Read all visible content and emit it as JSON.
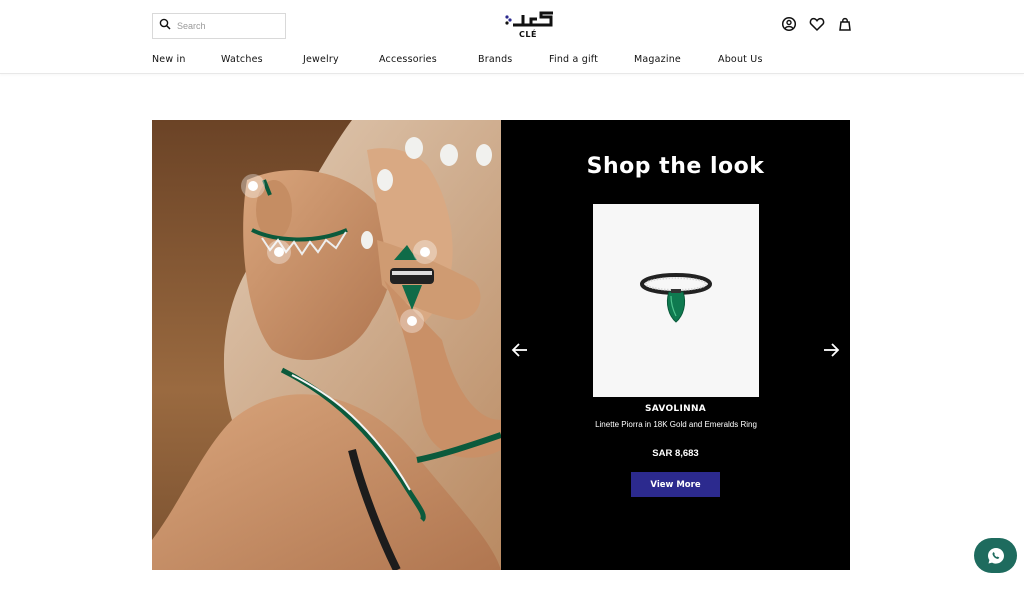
{
  "header": {
    "search": {
      "placeholder": "Search"
    },
    "logo_text": "CLÉ",
    "icons": [
      "account-icon",
      "heart-icon",
      "shopping-bag-icon"
    ]
  },
  "nav": {
    "items": [
      {
        "label": "New in"
      },
      {
        "label": "Watches"
      },
      {
        "label": "Jewelry"
      },
      {
        "label": "Accessories"
      },
      {
        "label": "Brands"
      },
      {
        "label": "Find a gift"
      },
      {
        "label": "Magazine"
      },
      {
        "label": "About Us"
      }
    ]
  },
  "shop_the_look": {
    "title": "Shop the look",
    "hotspots_count": 4,
    "product": {
      "brand": "SAVOLINNA",
      "name": "Linette Piorra in 18K Gold and Emeralds Ring",
      "price": "SAR 8,683",
      "button": "View More"
    }
  },
  "colors": {
    "accent": "#2c2a8e",
    "panel": "#000000",
    "chat": "#1e6b5e"
  }
}
